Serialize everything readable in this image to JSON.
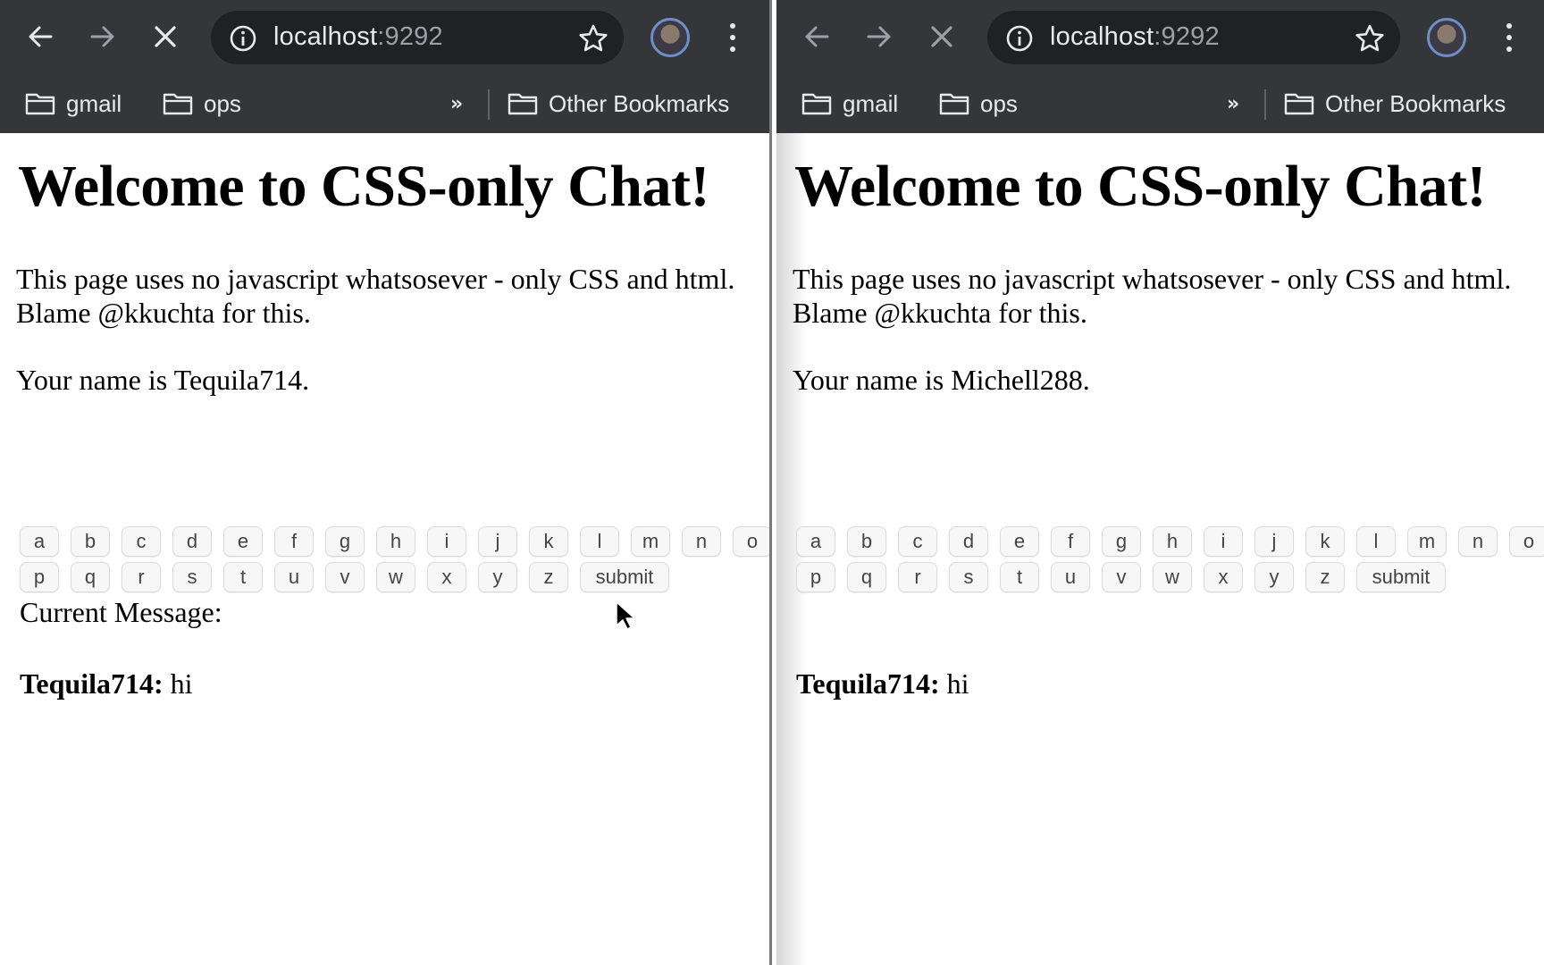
{
  "colors": {
    "toolbar_bg": "#35363a",
    "omnibox_bg": "#202124",
    "toolbar_text": "#e8eaed",
    "port_text": "#9aa0a6",
    "page_bg": "#ffffff",
    "page_text": "#000000",
    "key_bg": "#f7f7f7",
    "key_border": "#dadada"
  },
  "windows": [
    {
      "url_host": "localhost",
      "url_port": ":9292",
      "bookmarks": [
        {
          "label": "gmail",
          "icon": "folder-icon"
        },
        {
          "label": "ops",
          "icon": "folder-icon"
        }
      ],
      "overflow_label": "»",
      "other_bookmarks_label": "Other Bookmarks",
      "page": {
        "heading": "Welcome to CSS-only Chat!",
        "intro": "This page uses no javascript whatsosever - only CSS and html. Blame @kkuchta for this.",
        "name_line": "Your name is Tequila714.",
        "keys_row1": [
          "a",
          "b",
          "c",
          "d",
          "e",
          "f",
          "g",
          "h",
          "i",
          "j",
          "k",
          "l",
          "m",
          "n",
          "o"
        ],
        "keys_row2": [
          "p",
          "q",
          "r",
          "s",
          "t",
          "u",
          "v",
          "w",
          "x",
          "y",
          "z",
          "submit"
        ],
        "current_message_label": "Current Message:",
        "messages": [
          {
            "author": "Tequila714:",
            "text": "hi"
          }
        ]
      }
    },
    {
      "url_host": "localhost",
      "url_port": ":9292",
      "bookmarks": [
        {
          "label": "gmail",
          "icon": "folder-icon"
        },
        {
          "label": "ops",
          "icon": "folder-icon"
        }
      ],
      "overflow_label": "»",
      "other_bookmarks_label": "Other Bookmarks",
      "page": {
        "heading": "Welcome to CSS-only Chat!",
        "intro": "This page uses no javascript whatsosever - only CSS and html. Blame @kkuchta for this.",
        "name_line": "Your name is Michell288.",
        "keys_row1": [
          "a",
          "b",
          "c",
          "d",
          "e",
          "f",
          "g",
          "h",
          "i",
          "j",
          "k",
          "l",
          "m",
          "n",
          "o"
        ],
        "keys_row2": [
          "p",
          "q",
          "r",
          "s",
          "t",
          "u",
          "v",
          "w",
          "x",
          "y",
          "z",
          "submit"
        ],
        "current_message_label": "",
        "messages": [
          {
            "author": "Tequila714:",
            "text": "hi"
          }
        ]
      }
    }
  ]
}
